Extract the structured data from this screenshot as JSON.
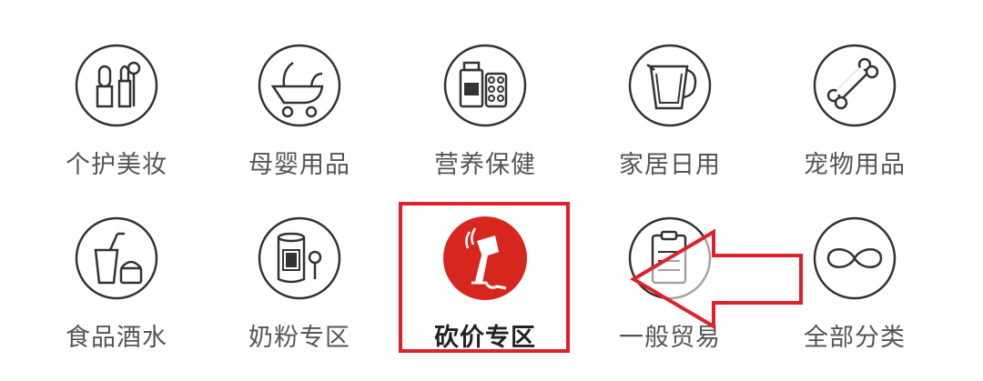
{
  "categories": [
    {
      "label": "个护美妆",
      "icon": "cosmetics-icon"
    },
    {
      "label": "母婴用品",
      "icon": "stroller-icon"
    },
    {
      "label": "营养保健",
      "icon": "supplements-icon"
    },
    {
      "label": "家居日用",
      "icon": "water-pitcher-icon"
    },
    {
      "label": "宠物用品",
      "icon": "bone-icon"
    },
    {
      "label": "食品酒水",
      "icon": "drinks-icon"
    },
    {
      "label": "奶粉专区",
      "icon": "milk-powder-icon"
    },
    {
      "label": "砍价专区",
      "icon": "axe-icon"
    },
    {
      "label": "一般贸易",
      "icon": "clipboard-icon"
    },
    {
      "label": "全部分类",
      "icon": "infinity-icon"
    }
  ],
  "colors": {
    "accent": "#d7261d",
    "highlight": "#e0202a",
    "icon_stroke": "#333333",
    "label": "#555555"
  }
}
